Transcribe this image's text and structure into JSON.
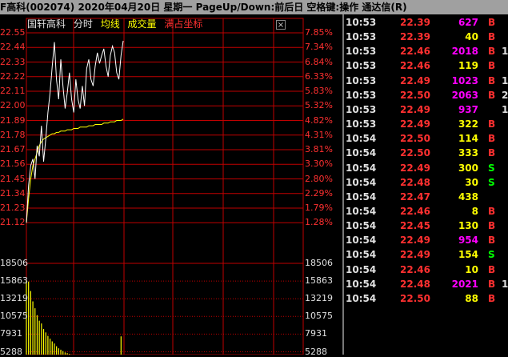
{
  "titlebar": {
    "text": "F高科(002074)  2020年04月20日 星期一  PageUp/Down:前后日 空格键:操作  通达信(R)"
  },
  "legend": {
    "stock_name": "国轩高科",
    "fenshi": "分时",
    "avg_line": "均线",
    "volume": "成交量",
    "full_scale": "满占坐标"
  },
  "close_icon": "×",
  "price_axis": {
    "left_labels": [
      "22.55",
      "22.44",
      "22.33",
      "22.22",
      "22.11",
      "22.00",
      "21.89",
      "21.78",
      "21.67",
      "21.56",
      "21.45",
      "21.34",
      "21.23",
      "21.12"
    ],
    "right_labels": [
      "7.85%",
      "7.34%",
      "6.84%",
      "6.33%",
      "5.83%",
      "5.32%",
      "4.82%",
      "4.31%",
      "3.81%",
      "3.30%",
      "2.80%",
      "2.29%",
      "1.79%",
      "1.28%"
    ]
  },
  "volume_axis": {
    "left_labels": [
      "18506",
      "15863",
      "13219",
      "10575",
      "7931",
      "5288"
    ],
    "right_labels": [
      "18506",
      "15863",
      "13219",
      "10575",
      "7931",
      "5288"
    ]
  },
  "colors": {
    "grid_red": "#c00000",
    "price_line": "#ffffff",
    "avg_line": "#ffff00",
    "volume_bar": "#ffff00",
    "up_text": "#ff3030",
    "down_text": "#00ff00",
    "buy_volume": "#ff3030",
    "sell_volume": "#00ff00",
    "neutral_volume": "#ffff00",
    "big_volume": "#ff00ff"
  },
  "chart_data": {
    "type": "line",
    "series": [
      {
        "values": [
          21.12,
          21.4,
          21.55,
          21.6,
          21.45,
          21.7,
          21.62,
          21.85,
          21.58,
          21.75,
          21.95,
          22.1,
          22.3,
          22.48,
          22.2,
          22.05,
          22.35,
          22.15,
          21.98,
          22.1,
          22.25,
          22.05,
          21.95,
          22.2,
          22.05,
          21.98,
          22.15,
          22.0,
          22.28,
          22.35,
          22.2,
          22.15,
          22.3,
          22.4,
          22.32,
          22.38,
          22.43,
          22.3,
          22.22,
          22.38,
          22.45,
          22.4,
          22.25,
          22.2,
          22.38,
          22.49
        ]
      },
      {
        "values": [
          21.12,
          21.3,
          21.45,
          21.55,
          21.6,
          21.65,
          21.7,
          21.73,
          21.75,
          21.76,
          21.77,
          21.78,
          21.79,
          21.79,
          21.8,
          21.8,
          21.81,
          21.81,
          21.81,
          21.82,
          21.82,
          21.82,
          21.83,
          21.83,
          21.83,
          21.84,
          21.84,
          21.84,
          21.84,
          21.85,
          21.85,
          21.85,
          21.86,
          21.86,
          21.86,
          21.86,
          21.87,
          21.87,
          21.87,
          21.88,
          21.88,
          21.88,
          21.89,
          21.89,
          21.89,
          21.9
        ]
      }
    ],
    "volume": [
      16000,
      15863,
      14500,
      13000,
      12000,
      11000,
      10200,
      9800,
      9000,
      8500,
      8000,
      7600,
      7200,
      6900,
      6500,
      6200,
      6000,
      5800,
      5600,
      5500,
      5400,
      5300,
      5300,
      5288,
      5288,
      5288,
      5288,
      5288,
      5288,
      5288,
      5288,
      5288,
      5288,
      5288,
      5288,
      5288,
      5288,
      5288,
      5288,
      5288,
      5288,
      5288,
      5288,
      5288,
      7931,
      5288
    ],
    "ylim_price": [
      21.12,
      22.55
    ],
    "ylim_volume": [
      5288,
      18506
    ]
  },
  "ticks": [
    {
      "time": "10:53",
      "price": "22.39",
      "vol": "627",
      "vol_color": "#ff00ff",
      "dir": "B",
      "dir_color": "#ff3030",
      "extra": ""
    },
    {
      "time": "10:53",
      "price": "22.39",
      "vol": "40",
      "vol_color": "#ffff00",
      "dir": "B",
      "dir_color": "#ff3030",
      "extra": ""
    },
    {
      "time": "10:53",
      "price": "22.46",
      "vol": "2018",
      "vol_color": "#ff00ff",
      "dir": "B",
      "dir_color": "#ff3030",
      "extra": "1"
    },
    {
      "time": "10:53",
      "price": "22.46",
      "vol": "119",
      "vol_color": "#ffff00",
      "dir": "B",
      "dir_color": "#ff3030",
      "extra": ""
    },
    {
      "time": "10:53",
      "price": "22.49",
      "vol": "1023",
      "vol_color": "#ff00ff",
      "dir": "B",
      "dir_color": "#ff3030",
      "extra": "1"
    },
    {
      "time": "10:53",
      "price": "22.50",
      "vol": "2063",
      "vol_color": "#ff00ff",
      "dir": "B",
      "dir_color": "#ff3030",
      "extra": "2"
    },
    {
      "time": "10:53",
      "price": "22.49",
      "vol": "937",
      "vol_color": "#ff00ff",
      "dir": "",
      "dir_color": "#ff3030",
      "extra": "1"
    },
    {
      "time": "10:53",
      "price": "22.49",
      "vol": "322",
      "vol_color": "#ffff00",
      "dir": "B",
      "dir_color": "#ff3030",
      "extra": ""
    },
    {
      "time": "10:54",
      "price": "22.50",
      "vol": "114",
      "vol_color": "#ffff00",
      "dir": "B",
      "dir_color": "#ff3030",
      "extra": ""
    },
    {
      "time": "10:54",
      "price": "22.50",
      "vol": "333",
      "vol_color": "#ffff00",
      "dir": "B",
      "dir_color": "#ff3030",
      "extra": ""
    },
    {
      "time": "10:54",
      "price": "22.49",
      "vol": "300",
      "vol_color": "#ffff00",
      "dir": "S",
      "dir_color": "#00ff00",
      "extra": ""
    },
    {
      "time": "10:54",
      "price": "22.48",
      "vol": "30",
      "vol_color": "#ffff00",
      "dir": "S",
      "dir_color": "#00ff00",
      "extra": ""
    },
    {
      "time": "10:54",
      "price": "22.47",
      "vol": "438",
      "vol_color": "#ffff00",
      "dir": "",
      "dir_color": "#ff3030",
      "extra": ""
    },
    {
      "time": "10:54",
      "price": "22.46",
      "vol": "8",
      "vol_color": "#ffff00",
      "dir": "B",
      "dir_color": "#ff3030",
      "extra": ""
    },
    {
      "time": "10:54",
      "price": "22.45",
      "vol": "130",
      "vol_color": "#ffff00",
      "dir": "B",
      "dir_color": "#ff3030",
      "extra": ""
    },
    {
      "time": "10:54",
      "price": "22.49",
      "vol": "954",
      "vol_color": "#ff00ff",
      "dir": "B",
      "dir_color": "#ff3030",
      "extra": ""
    },
    {
      "time": "10:54",
      "price": "22.49",
      "vol": "154",
      "vol_color": "#ffff00",
      "dir": "S",
      "dir_color": "#00ff00",
      "extra": ""
    },
    {
      "time": "10:54",
      "price": "22.46",
      "vol": "10",
      "vol_color": "#ffff00",
      "dir": "B",
      "dir_color": "#ff3030",
      "extra": ""
    },
    {
      "time": "10:54",
      "price": "22.48",
      "vol": "2021",
      "vol_color": "#ff00ff",
      "dir": "B",
      "dir_color": "#ff3030",
      "extra": "1"
    },
    {
      "time": "10:54",
      "price": "22.50",
      "vol": "88",
      "vol_color": "#ffff00",
      "dir": "B",
      "dir_color": "#ff3030",
      "extra": ""
    }
  ]
}
